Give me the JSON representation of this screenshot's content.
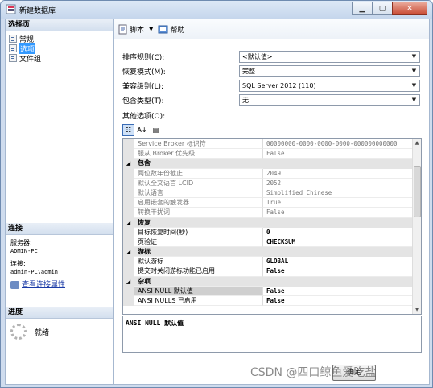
{
  "window": {
    "title": "新建数据库"
  },
  "left": {
    "header": "选择页",
    "pages": [
      {
        "label": "常规"
      },
      {
        "label": "选项"
      },
      {
        "label": "文件组"
      }
    ],
    "connection": {
      "header": "连接",
      "server_label": "服务器:",
      "server": "ADMIN-PC",
      "conn_label": "连接:",
      "conn": "admin-PC\\admin",
      "link": "查看连接属性"
    },
    "progress": {
      "header": "进度",
      "status": "就绪"
    }
  },
  "toolbar": {
    "script": "脚本",
    "help": "帮助"
  },
  "form": {
    "collation": {
      "label": "排序规则(C):",
      "value": "<默认值>"
    },
    "recovery": {
      "label": "恢复模式(M):",
      "value": "完整"
    },
    "compat": {
      "label": "兼容级别(L):",
      "value": "SQL Server 2012 (110)"
    },
    "containment": {
      "label": "包含类型(T):",
      "value": "无"
    },
    "other_label": "其他选项(O):"
  },
  "grid_rows": [
    {
      "name": "Service Broker 标识符",
      "value": "00000000-0000-0000-0000-000000000000"
    },
    {
      "name": "服从 Broker 优先级",
      "value": "False"
    },
    {
      "name": "包含"
    },
    {
      "name": "两位数年份截止",
      "value": "2049"
    },
    {
      "name": "默认全文语言 LCID",
      "value": "2052"
    },
    {
      "name": "默认语言",
      "value": "Simplified Chinese"
    },
    {
      "name": "启用嵌套的触发器",
      "value": "True"
    },
    {
      "name": "转换干扰词",
      "value": "False"
    },
    {
      "name": "恢复"
    },
    {
      "name": "目标恢复时间(秒)",
      "value": "0"
    },
    {
      "name": "页验证",
      "value": "CHECKSUM"
    },
    {
      "name": "游标"
    },
    {
      "name": "默认游标",
      "value": "GLOBAL"
    },
    {
      "name": "提交时关闭游标功能已启用",
      "value": "False"
    },
    {
      "name": "杂项"
    },
    {
      "name": "ANSI NULL 默认值",
      "value": "False"
    },
    {
      "name": "ANSI NULLS 已启用",
      "value": "False"
    }
  ],
  "description": "ANSI NULL 默认值",
  "ok_label": "确定",
  "watermark": "CSDN @四口鲸鱼爱吃盐"
}
